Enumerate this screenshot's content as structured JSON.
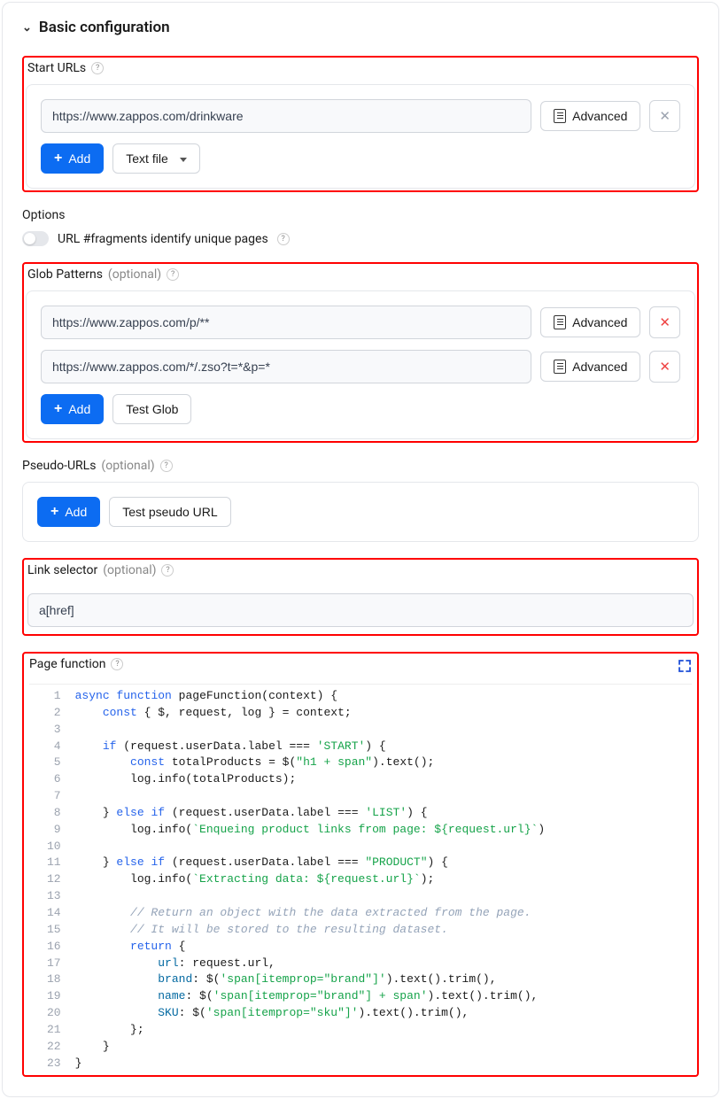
{
  "panel": {
    "title": "Basic configuration"
  },
  "startUrls": {
    "label": "Start URLs",
    "value": "https://www.zappos.com/drinkware",
    "advanced": "Advanced",
    "add": "Add",
    "textFile": "Text file"
  },
  "options": {
    "label": "Options",
    "fragments": "URL #fragments identify unique pages"
  },
  "glob": {
    "label": "Glob Patterns",
    "optional": "(optional)",
    "rows": [
      "https://www.zappos.com/p/**",
      "https://www.zappos.com/*/.zso?t=*&p=*"
    ],
    "advanced": "Advanced",
    "add": "Add",
    "test": "Test Glob"
  },
  "pseudo": {
    "label": "Pseudo-URLs",
    "optional": "(optional)",
    "add": "Add",
    "test": "Test pseudo URL"
  },
  "linkSelector": {
    "label": "Link selector",
    "optional": "(optional)",
    "value": "a[href]"
  },
  "pageFunction": {
    "label": "Page function",
    "code": "async function pageFunction(context) {\n    const { $, request, log } = context;\n\n    if (request.userData.label === 'START') {\n        const totalProducts = $(\"h1 + span\").text();\n        log.info(totalProducts);\n\n    } else if (request.userData.label === 'LIST') {\n        log.info(`Enqueing product links from page: ${request.url}`)\n\n    } else if (request.userData.label === \"PRODUCT\") {\n        log.info(`Extracting data: ${request.url}`);\n\n        // Return an object with the data extracted from the page.\n        // It will be stored to the resulting dataset.\n        return {\n            url: request.url,\n            brand: $('span[itemprop=\"brand\"]').text().trim(),\n            name: $('span[itemprop=\"brand\"] + span').text().trim(),\n            SKU: $('span[itemprop=\"sku\"]').text().trim(),\n        };\n    }\n}"
  }
}
